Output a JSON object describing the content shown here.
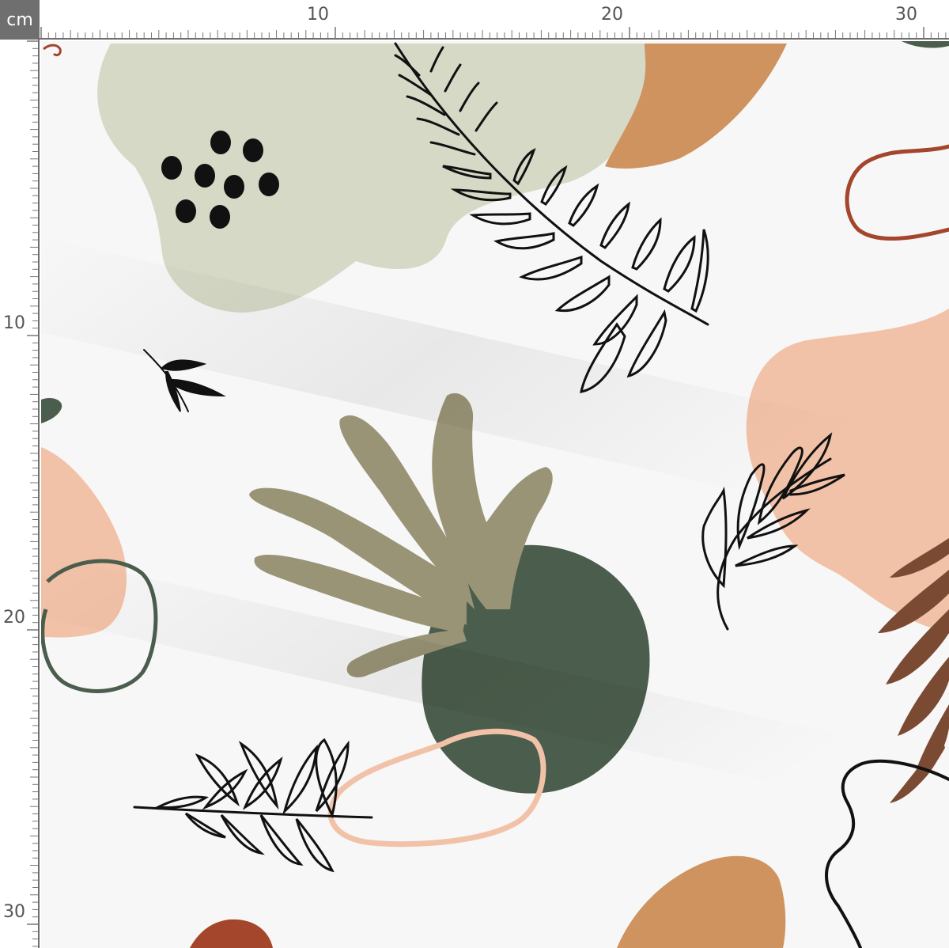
{
  "ruler": {
    "unit_label": "cm",
    "top_labels": [
      "10",
      "20",
      "30"
    ],
    "left_labels": [
      "10",
      "20",
      "30"
    ]
  },
  "pattern": {
    "colors": {
      "sage": "#d6d9c6",
      "olive": "#9a9477",
      "forest": "#4b5d4c",
      "peach": "#f2c2a8",
      "terracotta": "#cf935f",
      "rust": "#a3462c",
      "brown": "#7a4a33",
      "ink": "#111111"
    }
  }
}
